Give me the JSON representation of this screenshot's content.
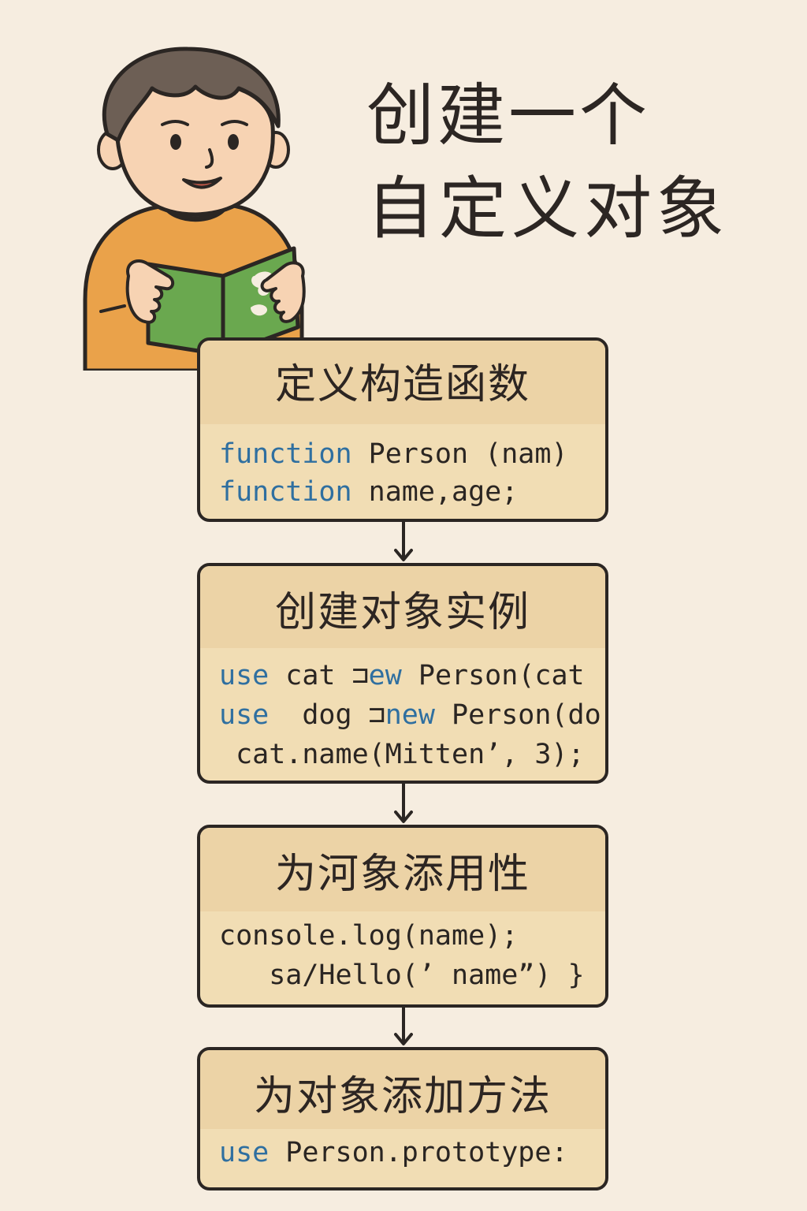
{
  "title": {
    "line1": "创建一个",
    "line2": "自定义对象"
  },
  "steps": [
    {
      "heading": "定义构造函数",
      "code": [
        {
          "kw": "function",
          "rest": " Person (nam)"
        },
        {
          "kw": "function",
          "rest": " name,age;",
          "prefix": ""
        }
      ]
    },
    {
      "heading": "创建对象实例",
      "code": [
        {
          "kw": "use",
          "rest1": " cat ⊐",
          "kw2": "ew",
          "rest2": " Person(cat"
        },
        {
          "kw": "use",
          "rest1": "  dog ⊐",
          "kw2": "new",
          "rest2": " Person(do"
        },
        {
          "text": " cat.name(Mitten’, 3);"
        }
      ]
    },
    {
      "heading": "为河象添用性",
      "code": [
        {
          "text": "console.log(name);"
        },
        {
          "text": "   sa/Hello(’ name”) }"
        }
      ]
    },
    {
      "heading": "为对象添加方法",
      "code": [
        {
          "kw": "use",
          "rest": " Person.prototype:"
        }
      ]
    }
  ],
  "colors": {
    "background": "#f6ede0",
    "box_fill": "#f1ddb4",
    "box_border": "#2b2623",
    "keyword": "#2f6fa0",
    "shirt": "#eaa24a",
    "book": "#6aa84f"
  },
  "icons": {
    "illustration": "boy-reading-book-icon",
    "flow_arrow": "arrow-down-icon"
  }
}
